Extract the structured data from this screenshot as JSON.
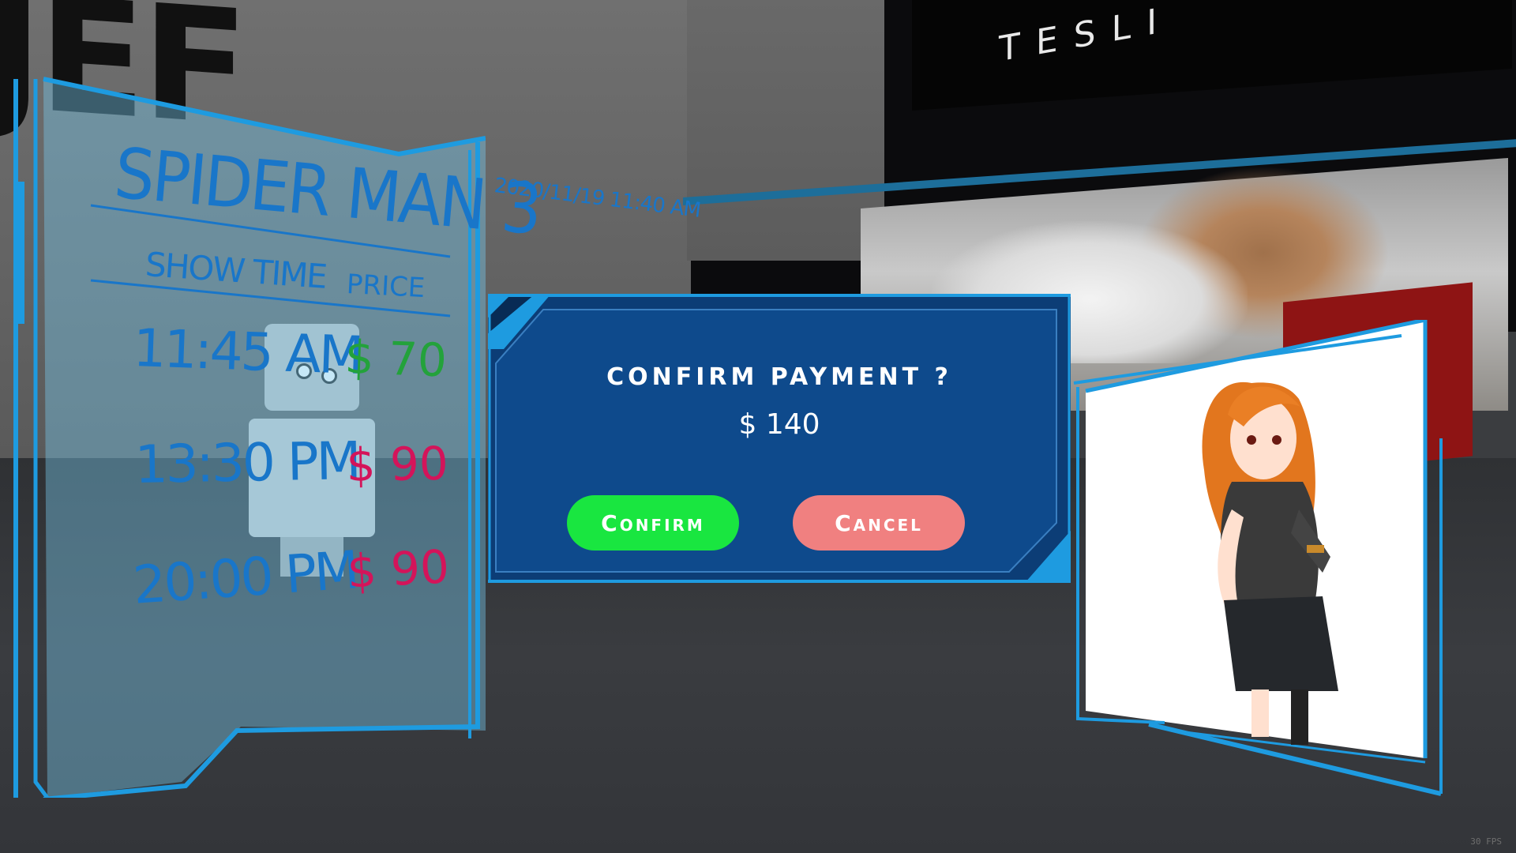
{
  "background": {
    "brand_sign": "TESLI",
    "wall_letters": "JEF"
  },
  "movie_panel": {
    "title": "SPIDER MAN 3",
    "timestamp": "2020/11/19 11:40 AM",
    "columns": {
      "show_time": "SHOW TIME",
      "price": "PRICE"
    },
    "showtimes": [
      {
        "time": "11:45  AM",
        "price": "$ 70",
        "price_color": "#23a23b"
      },
      {
        "time": "13:30 PM",
        "price": "$ 90",
        "price_color": "#d4145a"
      },
      {
        "time": "20:00 PM",
        "price": "$ 90",
        "price_color": "#d4145a"
      }
    ],
    "frame_color": "#1e9be0"
  },
  "dialog": {
    "title": "CONFIRM PAYMENT ?",
    "amount": "$ 140",
    "confirm_label": "Confirm",
    "cancel_label": "Cancel",
    "background_color": "#0e4a8c",
    "confirm_color": "#19e640",
    "cancel_color": "#f08080"
  },
  "character_panel": {
    "frame_color": "#1e9be0",
    "avatar_icon": "anime-girl-avatar"
  },
  "fps_label": "30 FPS"
}
